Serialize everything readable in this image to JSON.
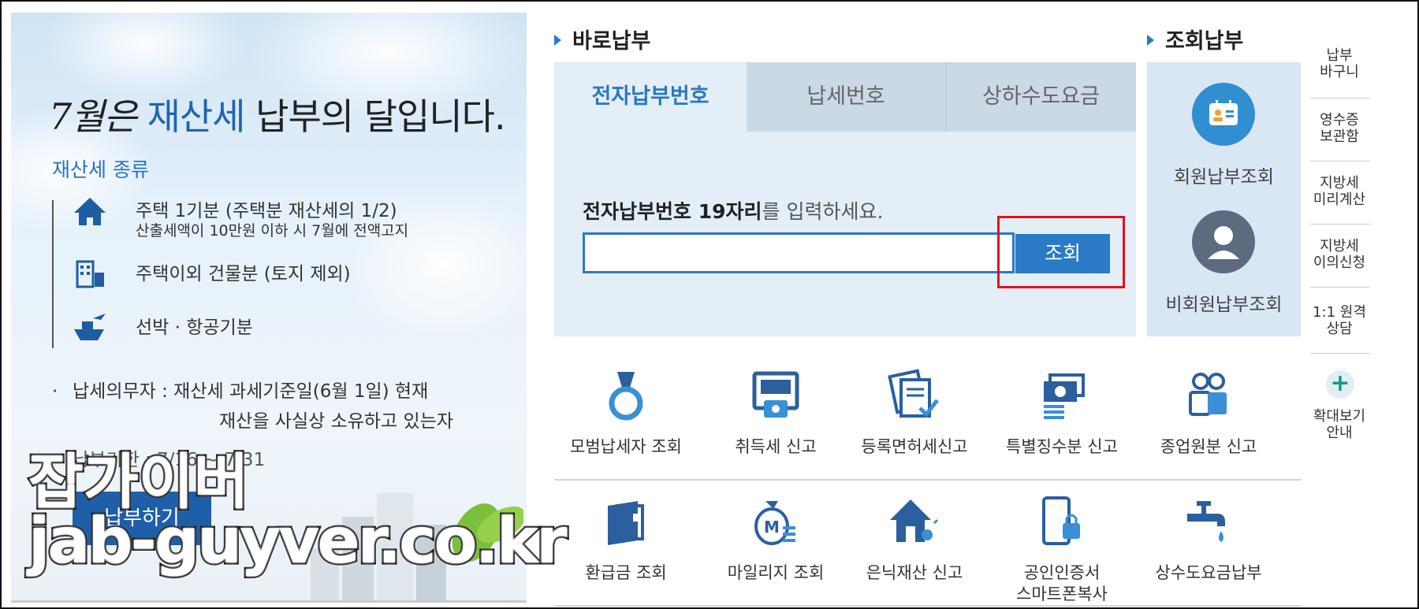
{
  "banner": {
    "headline_month": "7월은",
    "headline_accent": "재산세",
    "headline_rest": "납부의 달입니다.",
    "types_title": "재산세 종류",
    "type_items": [
      {
        "icon": "house-icon",
        "label": "주택 1기분 (주택분 재산세의 1/2)",
        "sub": "산출세액이 10만원 이하 시 7월에 전액고지"
      },
      {
        "icon": "building-icon",
        "label": "주택이외 건물분 (토지 제외)",
        "sub": ""
      },
      {
        "icon": "ship-plane-icon",
        "label": "선박 · 항공기분",
        "sub": ""
      }
    ],
    "duty_bullet": "·",
    "duty_line1": "납세의무자 : 재산세 과세기준일(6월 1일) 현재",
    "duty_line2": "재산을 사실상 소유하고 있는자",
    "deadline": "납부기한 : 7/16 ~ 7/31",
    "pay_button": "납부하기"
  },
  "watermark": {
    "line1": "잡가이버",
    "line2": "jab-guyver.co.kr"
  },
  "quick_pay": {
    "title": "바로납부",
    "tabs": [
      "전자납부번호",
      "납세번호",
      "상하수도요금"
    ],
    "prompt_bold": "전자납부번호 19자리",
    "prompt_rest": "를 입력하세요.",
    "input_value": "",
    "search_button": "조회"
  },
  "inquiry_pay": {
    "title": "조회납부",
    "member": "회원납부조회",
    "nonmember": "비회원납부조회"
  },
  "side_menu": [
    "납부\n바구니",
    "영수증\n보관함",
    "지방세\n미리계산",
    "지방세\n이의신청",
    "1:1 원격\n상담",
    "확대보기\n안내"
  ],
  "services": [
    {
      "icon": "medal-icon",
      "label": "모범납세자 조회"
    },
    {
      "icon": "atm-icon",
      "label": "취득세 신고"
    },
    {
      "icon": "document-check-icon",
      "label": "등록면허세신고"
    },
    {
      "icon": "money-stack-icon",
      "label": "특별징수분 신고"
    },
    {
      "icon": "employees-icon",
      "label": "종업원분 신고"
    },
    {
      "icon": "wallet-icon",
      "label": "환급금 조회"
    },
    {
      "icon": "mileage-icon",
      "label": "마일리지 조회"
    },
    {
      "icon": "house-alert-icon",
      "label": "은닉재산 신고"
    },
    {
      "icon": "phone-lock-icon",
      "label": "공인인증서\n스마트폰복사"
    },
    {
      "icon": "faucet-icon",
      "label": "상수도요금납부"
    }
  ],
  "colors": {
    "accent": "#2b7ac6",
    "highlight": "#e0121a",
    "headline_accent": "#1d66b3"
  }
}
